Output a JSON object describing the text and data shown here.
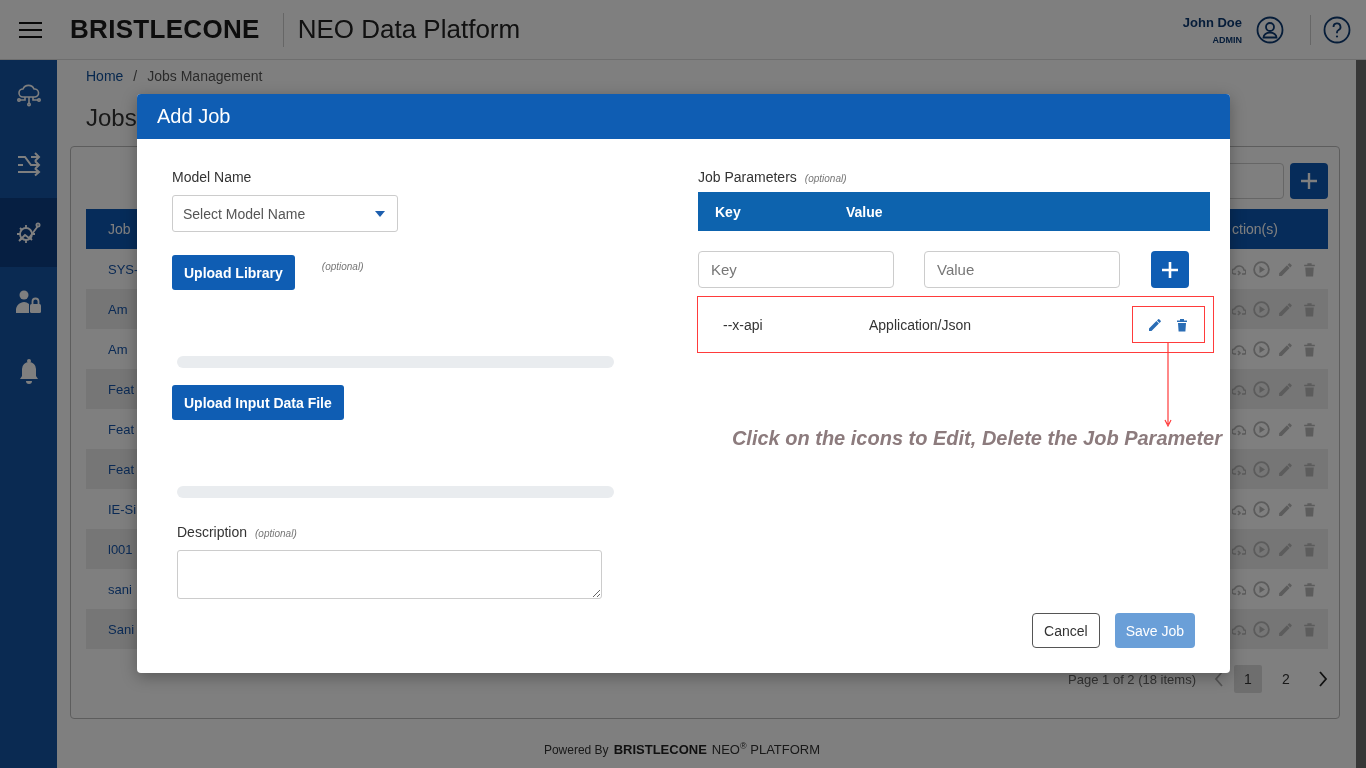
{
  "header": {
    "logo": "BRISTLECONE",
    "title": "NEO Data Platform",
    "user": {
      "name": "John Doe",
      "role": "ADMIN"
    }
  },
  "sidebar": {
    "items": [
      {
        "kind": "cloud",
        "selected": false
      },
      {
        "kind": "flows",
        "selected": false
      },
      {
        "kind": "jobs",
        "selected": true
      },
      {
        "kind": "access",
        "selected": false
      },
      {
        "kind": "alerts",
        "selected": false
      }
    ]
  },
  "breadcrumb": {
    "items": [
      "Home",
      "Jobs Management"
    ],
    "separator": "/"
  },
  "page_title": "Jobs",
  "jobs_table": {
    "columns": [
      "Job",
      "ction(s)"
    ],
    "rows": [
      "SYS-",
      "Am",
      "Am",
      "Feat",
      "Feat",
      "Feat",
      "IE-Si",
      "l001",
      "sani",
      "Sani"
    ]
  },
  "pagination": {
    "summary": "Page 1 of 2 (18 items)",
    "pages": [
      {
        "label": "1",
        "selected": true
      },
      {
        "label": "2",
        "selected": false
      }
    ]
  },
  "footer": {
    "powered_by": "Powered By",
    "brand": "BRISTLECONE",
    "product": "NEO",
    "mark": "®",
    "platform": "PLATFORM"
  },
  "dialog": {
    "title": "Add Job",
    "model_name": {
      "label": "Model Name",
      "placeholder": "Select Model Name"
    },
    "upload_library": {
      "button": "Upload Library",
      "note": "(optional)",
      "level": 0
    },
    "upload_input": {
      "button": "Upload Input Data File",
      "level": 0
    },
    "description": {
      "label": "Description",
      "note": "(optional)"
    },
    "job_parameters": {
      "label": "Job Parameters",
      "note": "(optional)",
      "columns": [
        "Key",
        "Value"
      ],
      "key_placeholder": "Key",
      "value_placeholder": "Value",
      "rows": [
        {
          "key": "--x-api",
          "value": "Application/Json"
        }
      ]
    },
    "buttons": [
      {
        "label": "Cancel",
        "kind": "secondary",
        "disabled": false
      },
      {
        "label": "Save Job",
        "kind": "primary",
        "disabled": true
      }
    ]
  },
  "annotation": {
    "text": "Click on the icons to Edit, Delete the Job Parameter"
  }
}
